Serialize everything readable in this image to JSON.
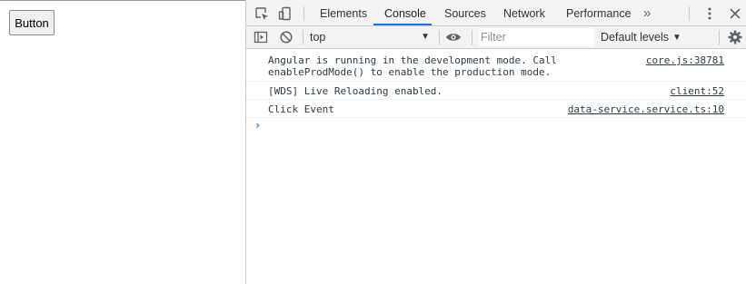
{
  "page": {
    "button_label": "Button"
  },
  "devtools": {
    "tabs": [
      {
        "label": "Elements",
        "active": false
      },
      {
        "label": "Console",
        "active": true
      },
      {
        "label": "Sources",
        "active": false
      },
      {
        "label": "Network",
        "active": false
      },
      {
        "label": "Performance",
        "active": false
      }
    ],
    "more_tabs_glyph": "»",
    "toolbar": {
      "context": "top",
      "filter_placeholder": "Filter",
      "levels_label": "Default levels"
    },
    "console": {
      "messages": [
        {
          "lines": [
            "Angular is running in the development mode. Call",
            "enableProdMode() to enable the production mode."
          ],
          "source": "core.js:38781"
        },
        {
          "lines": [
            "[WDS] Live Reloading enabled."
          ],
          "source": "client:52"
        },
        {
          "lines": [
            "Click Event"
          ],
          "source": "data-service.service.ts:10"
        }
      ],
      "prompt_glyph": "›"
    }
  },
  "colors": {
    "accent": "#1a73e8",
    "toolbar_bg": "#f3f3f3",
    "text": "#303942"
  }
}
